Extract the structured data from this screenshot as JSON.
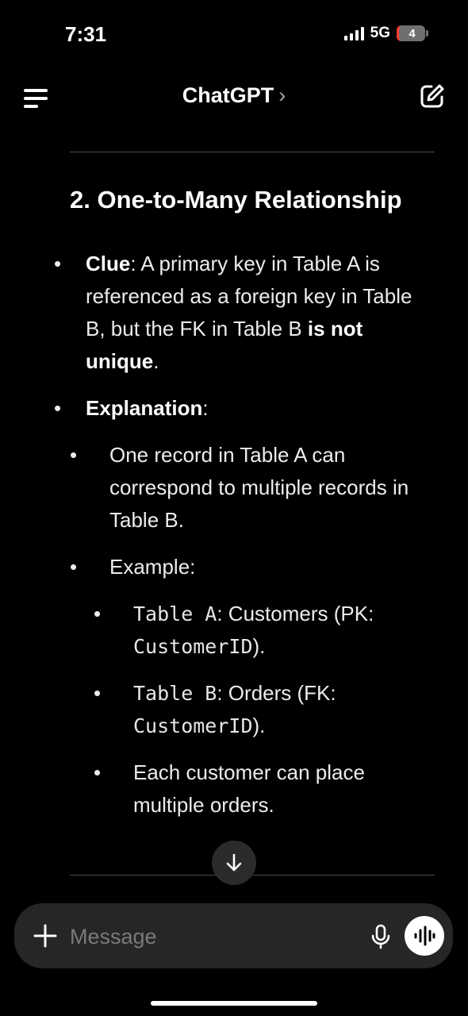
{
  "status_bar": {
    "time": "7:31",
    "network": "5G",
    "battery": "4"
  },
  "header": {
    "title": "ChatGPT",
    "chevron": "›"
  },
  "content": {
    "heading": "2. One-to-Many Relationship",
    "clue": {
      "label": "Clue",
      "text_a": ": A primary key in Table A is referenced as a foreign key in Table B, but the FK in Table B ",
      "bold": "is not unique",
      "text_b": "."
    },
    "explanation": {
      "label": "Explanation",
      "suffix": ":",
      "point1": "One record in Table A can correspond to multiple records in Table B.",
      "example_label": "Example:",
      "examples": [
        {
          "code": "Table A",
          "text": ": Customers (PK: ",
          "code2": "CustomerID",
          "text2": ")."
        },
        {
          "code": "Table B",
          "text": ": Orders (FK: ",
          "code2": "CustomerID",
          "text2": ")."
        },
        {
          "text": "Each customer can place multiple orders."
        }
      ]
    }
  },
  "composer": {
    "placeholder": "Message"
  },
  "icons": {
    "menu": "menu-icon",
    "edit": "compose-icon",
    "scroll": "arrow-down-icon",
    "plus": "plus-icon",
    "mic": "microphone-icon",
    "voice": "voice-waveform-icon"
  }
}
